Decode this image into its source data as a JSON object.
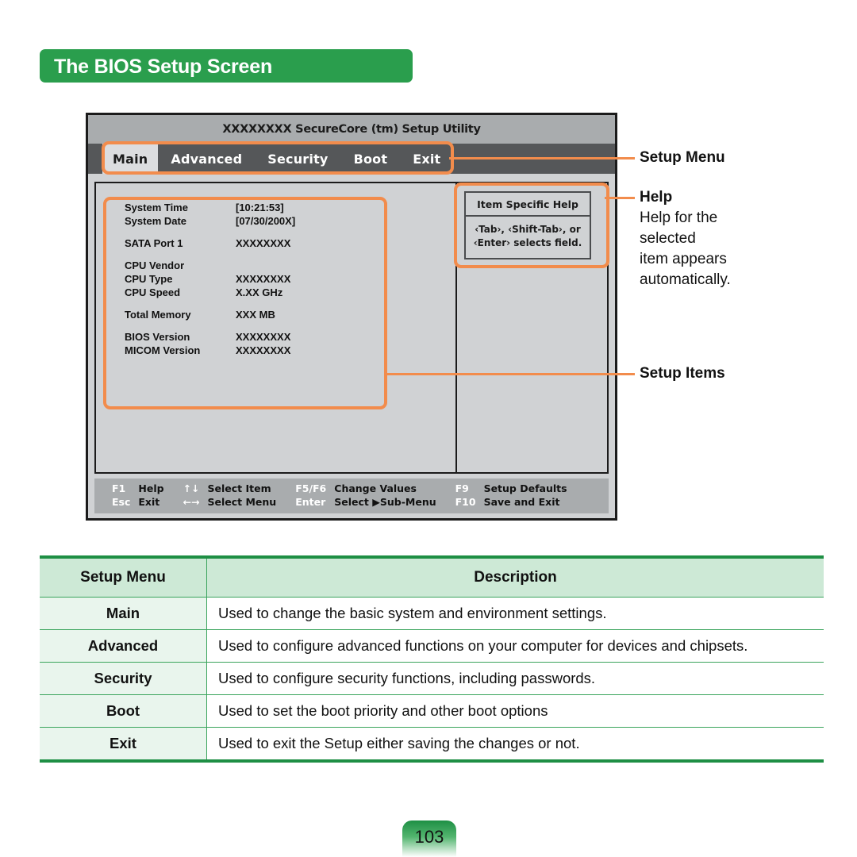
{
  "banner": {
    "title": "The BIOS Setup Screen"
  },
  "bios": {
    "title": "XXXXXXXX SecureCore (tm) Setup Utility",
    "tabs": [
      {
        "label": "Main",
        "active": true
      },
      {
        "label": "Advanced",
        "active": false
      },
      {
        "label": "Security",
        "active": false
      },
      {
        "label": "Boot",
        "active": false
      },
      {
        "label": "Exit",
        "active": false
      }
    ],
    "items": [
      {
        "key": "System Time",
        "value": "[10:21:53]"
      },
      {
        "key": "System Date",
        "value": "[07/30/200X]"
      },
      {
        "key": "",
        "value": ""
      },
      {
        "key": "SATA Port 1",
        "value": "XXXXXXXX"
      },
      {
        "key": "",
        "value": ""
      },
      {
        "key": "CPU Vendor",
        "value": ""
      },
      {
        "key": "CPU Type",
        "value": "XXXXXXXX"
      },
      {
        "key": "CPU Speed",
        "value": "X.XX GHz"
      },
      {
        "key": "",
        "value": ""
      },
      {
        "key": "Total Memory",
        "value": "XXX MB"
      },
      {
        "key": "",
        "value": ""
      },
      {
        "key": "BIOS Version",
        "value": "XXXXXXXX"
      },
      {
        "key": "MICOM Version",
        "value": " XXXXXXXX"
      }
    ],
    "help": {
      "title": "Item Specific Help",
      "line1": "‹Tab›, ‹Shift-Tab›, or",
      "line2": "‹Enter› selects field."
    },
    "fkeys": [
      {
        "key": "F1",
        "action": "Help",
        "key2": "↑↓",
        "action2": "Select Item",
        "key3": "F5/F6",
        "action3": "Change Values",
        "key4": "F9",
        "action4": "Setup Defaults"
      },
      {
        "key": "Esc",
        "action": "Exit",
        "key2": "←→",
        "action2": "Select Menu",
        "key3": "Enter",
        "action3": "Select ▶Sub-Menu",
        "key4": "F10",
        "action4": "Save and Exit"
      }
    ]
  },
  "callouts": {
    "setup_menu": "Setup Menu",
    "help": "Help",
    "help_desc_l1": "Help for the",
    "help_desc_l2": "selected",
    "help_desc_l3": "item appears",
    "help_desc_l4": "automatically.",
    "setup_items": "Setup Items"
  },
  "table": {
    "headers": [
      "Setup Menu",
      "Description"
    ],
    "rows": [
      {
        "menu": "Main",
        "description": "Used to change the basic system and environment settings."
      },
      {
        "menu": "Advanced",
        "description": "Used to configure advanced functions on your computer for devices and chipsets."
      },
      {
        "menu": "Security",
        "description": "Used to configure security functions, including passwords."
      },
      {
        "menu": "Boot",
        "description": "Used to set the boot priority and other boot options"
      },
      {
        "menu": "Exit",
        "description": "Used to exit the Setup either saving the changes or not."
      }
    ]
  },
  "page_number": "103",
  "colors": {
    "brand_green": "#2a9e4d",
    "table_border_green": "#1e8f44",
    "annotation_orange": "#f28c4c",
    "bios_titlebar_gray": "#a9acae",
    "bios_menubar_gray": "#555759",
    "bios_body_gray": "#d0d2d4"
  }
}
